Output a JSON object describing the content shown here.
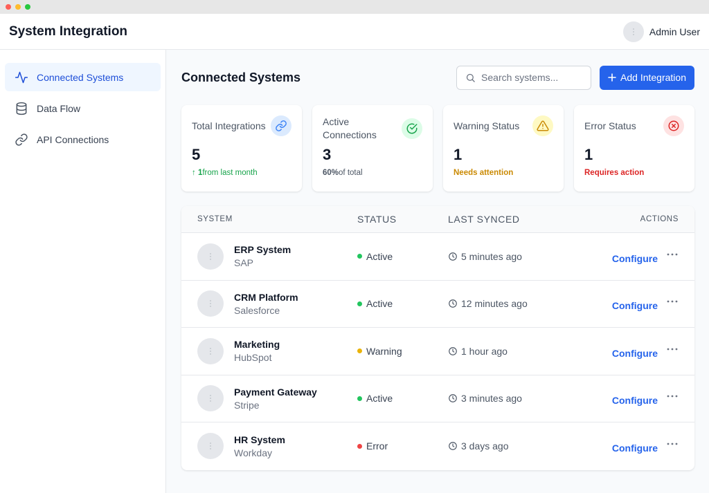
{
  "app": {
    "title": "System Integration",
    "user_name": "Admin User"
  },
  "sidebar": {
    "items": [
      {
        "label": "Connected Systems",
        "icon": "activity-icon",
        "active": true
      },
      {
        "label": "Data Flow",
        "icon": "database-icon",
        "active": false
      },
      {
        "label": "API Connections",
        "icon": "link-icon",
        "active": false
      }
    ]
  },
  "main": {
    "title": "Connected Systems",
    "search_placeholder": "Search systems...",
    "add_button": "Add Integration"
  },
  "stats": [
    {
      "label": "Total Integrations",
      "value": "5",
      "sub_bold": "1",
      "sub_text": "from last month",
      "icon": "link-icon",
      "color": "#3b82f6",
      "bg": "#dbeafe",
      "sub_color": "#16a34a"
    },
    {
      "label": "Active Connections",
      "value": "3",
      "sub_bold": "60%",
      "sub_text": "of total",
      "icon": "check-circle-icon",
      "color": "#16a34a",
      "bg": "#dcfce7",
      "sub_color": "#4b5563"
    },
    {
      "label": "Warning Status",
      "value": "1",
      "sub_bold": "Needs attention",
      "sub_text": "",
      "icon": "warning-icon",
      "color": "#ca8a04",
      "bg": "#fef9c3",
      "sub_color": "#ca8a04"
    },
    {
      "label": "Error Status",
      "value": "1",
      "sub_bold": "Requires action",
      "sub_text": "",
      "icon": "x-circle-icon",
      "color": "#dc2626",
      "bg": "#fee2e2",
      "sub_color": "#dc2626"
    }
  ],
  "table": {
    "headers": {
      "system": "SYSTEM",
      "status": "STATUS",
      "last_synced": "LAST SYNCED",
      "actions": "ACTIONS"
    },
    "action_label": "Configure",
    "rows": [
      {
        "name": "ERP System",
        "vendor": "SAP",
        "status": "Active",
        "status_color": "#22c55e",
        "synced": "5 minutes ago"
      },
      {
        "name": "CRM Platform",
        "vendor": "Salesforce",
        "status": "Active",
        "status_color": "#22c55e",
        "synced": "12 minutes ago"
      },
      {
        "name": "Marketing",
        "vendor": "HubSpot",
        "status": "Warning",
        "status_color": "#eab308",
        "synced": "1 hour ago"
      },
      {
        "name": "Payment Gateway",
        "vendor": "Stripe",
        "status": "Active",
        "status_color": "#22c55e",
        "synced": "3 minutes ago"
      },
      {
        "name": "HR System",
        "vendor": "Workday",
        "status": "Error",
        "status_color": "#ef4444",
        "synced": "3 days ago"
      }
    ]
  }
}
